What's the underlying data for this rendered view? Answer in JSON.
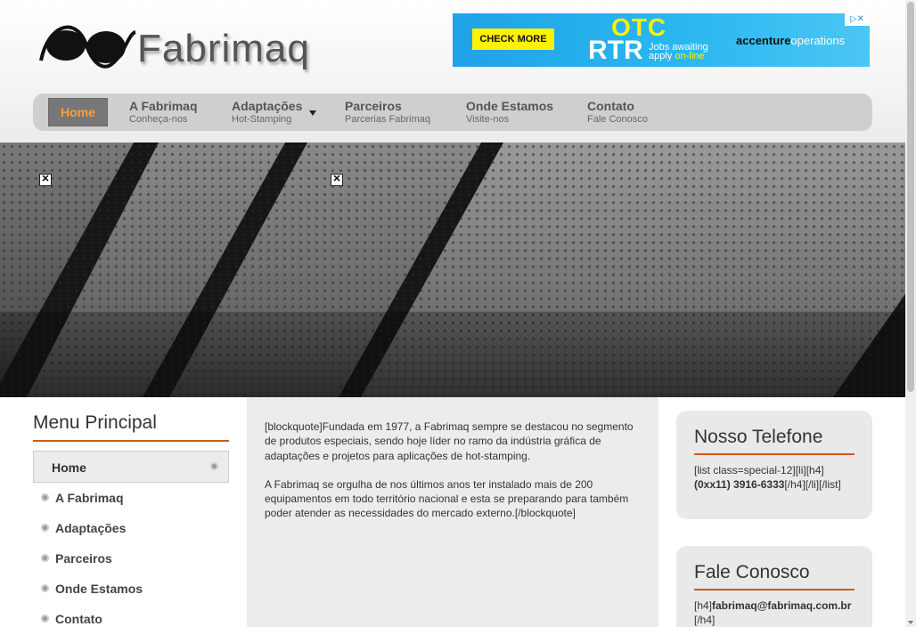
{
  "logo": {
    "text": "Fabrimaq",
    "icon": "glasses-logo-icon"
  },
  "ad": {
    "check_label": "CHECK MORE",
    "headline_top": "OTC",
    "headline_bottom": "RTR",
    "jobs_line1": "Jobs awaiting",
    "jobs_line2a": "apply",
    "jobs_line2b": "on-line",
    "brand_a": "accenture",
    "brand_b": "operations",
    "close_icon": "ad-choices-close-icon",
    "colors": {
      "background": "#2ab7f0",
      "accent": "#fff200"
    }
  },
  "nav": {
    "items": [
      {
        "title": "Home",
        "sub": ""
      },
      {
        "title": "A Fabrimaq",
        "sub": "Conheça-nos"
      },
      {
        "title": "Adaptações",
        "sub": "Hot-Stamping"
      },
      {
        "title": "Parceiros",
        "sub": "Parcerias Fabrimaq"
      },
      {
        "title": "Onde Estamos",
        "sub": "Visite-nos"
      },
      {
        "title": "Contato",
        "sub": "Fale Conosco"
      }
    ],
    "active_color": "#ff9f3a"
  },
  "sidebar": {
    "title": "Menu Principal",
    "items": [
      "Home",
      "A Fabrimaq",
      "Adaptações",
      "Parceiros",
      "Onde Estamos",
      "Contato"
    ]
  },
  "main": {
    "para1": "[blockquote]Fundada em 1977, a Fabrimaq sempre se destacou no segmento de produtos especiais, sendo hoje líder no ramo da indústria gráfica de adaptações e projetos para aplicações de hot-stamping.",
    "para2": "A Fabrimaq se orgulha de nos últimos anos ter instalado mais de 200 equipamentos em todo território nacional e esta se preparando para também poder atender as necessidades do mercado externo.[/blockquote]"
  },
  "phone_card": {
    "title": "Nosso Telefone",
    "prefix": "[list class=special-12][li][h4]",
    "number": "(0xx11) 3916-6333",
    "suffix": "[/h4][/li][/list]"
  },
  "contact_card": {
    "title": "Fale Conosco",
    "prefix": "[h4]",
    "email": "fabrimaq@fabrimaq.com.br",
    "suffix": "[/h4]"
  },
  "theme": {
    "accent_line": "#cc5a12"
  }
}
